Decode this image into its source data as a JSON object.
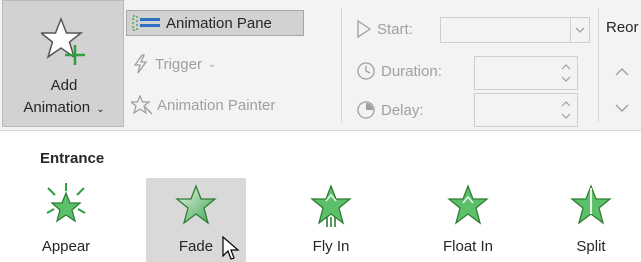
{
  "ribbon": {
    "add_animation": {
      "line1": "Add",
      "line2": "Animation",
      "chevron": "⌄"
    },
    "animation_pane": "Animation Pane",
    "trigger": "Trigger",
    "trigger_chevron": "⌄",
    "animation_painter": "Animation Painter",
    "timing": {
      "start_label": "Start:",
      "duration_label": "Duration:",
      "delay_label": "Delay:",
      "start_value": "",
      "duration_value": "",
      "delay_value": ""
    },
    "reorder_label": "Reor"
  },
  "gallery": {
    "section": "Entrance",
    "effects": [
      {
        "label": "Appear"
      },
      {
        "label": "Fade"
      },
      {
        "label": "Fly In"
      },
      {
        "label": "Float In"
      },
      {
        "label": "Split"
      }
    ],
    "hovered_effect": "Fade"
  },
  "colors": {
    "star_green": "#2e9e3e",
    "ribbon_bg": "#f3f3f3",
    "selected_bg": "#d2d2d2",
    "hover_bg": "#d9d9d9",
    "disabled_text": "#a0a0a0",
    "pane_icon": "#2f9e3e"
  },
  "icons": {
    "add_animation": "star-plus-icon",
    "animation_pane": "animation-pane-icon",
    "trigger": "lightning-icon",
    "painter": "star-brush-icon",
    "start": "play-triangle-icon",
    "duration": "clock-icon",
    "delay": "clock-delay-icon"
  }
}
